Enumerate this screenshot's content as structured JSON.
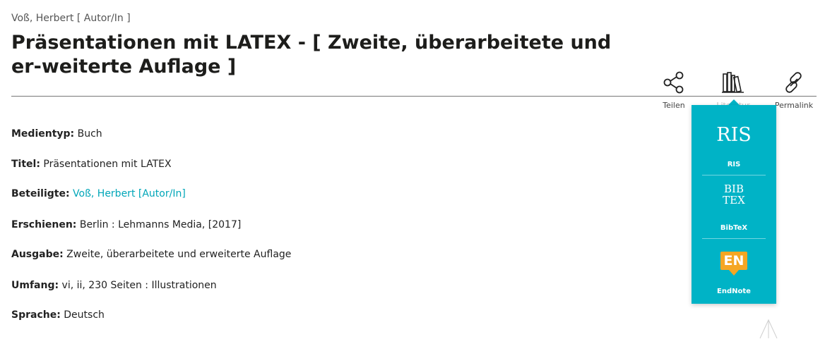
{
  "record": {
    "author_line": "Voß, Herbert [ Autor/In ]",
    "title": "Präsentationen mit LATEX - [ Zweite, überarbeitete und er-weiterte Auflage ]"
  },
  "toolbar": {
    "share": {
      "label": "Teilen",
      "icon": "share-icon"
    },
    "literature": {
      "label": "Literatur",
      "icon": "books-icon"
    },
    "permalink": {
      "label": "Permalink",
      "icon": "link-icon"
    }
  },
  "export_menu": {
    "ris": {
      "mark": "RIS",
      "label": "RIS"
    },
    "bibtex": {
      "mark_top": "BIB",
      "mark_bottom": "TEX",
      "label": "BibTeX"
    },
    "endnote": {
      "mark": "EN",
      "label": "EndNote"
    }
  },
  "details": {
    "medientyp": {
      "label": "Medientyp:",
      "value": "Buch"
    },
    "titel": {
      "label": "Titel:",
      "value": "Präsentationen mit LATEX"
    },
    "beteiligte": {
      "label": "Beteiligte:",
      "value": "Voß, Herbert [Autor/In]"
    },
    "erschienen": {
      "label": "Erschienen:",
      "value": "Berlin : Lehmanns Media, [2017]"
    },
    "ausgabe": {
      "label": "Ausgabe:",
      "value": "Zweite, überarbeitete und erweiterte Auflage"
    },
    "umfang": {
      "label": "Umfang:",
      "value": "vi, ii, 230 Seiten : Illustrationen"
    },
    "sprache": {
      "label": "Sprache:",
      "value": "Deutsch"
    }
  },
  "colors": {
    "accent": "#00b3c6",
    "link": "#00a6b8",
    "endnote": "#f5a623"
  }
}
